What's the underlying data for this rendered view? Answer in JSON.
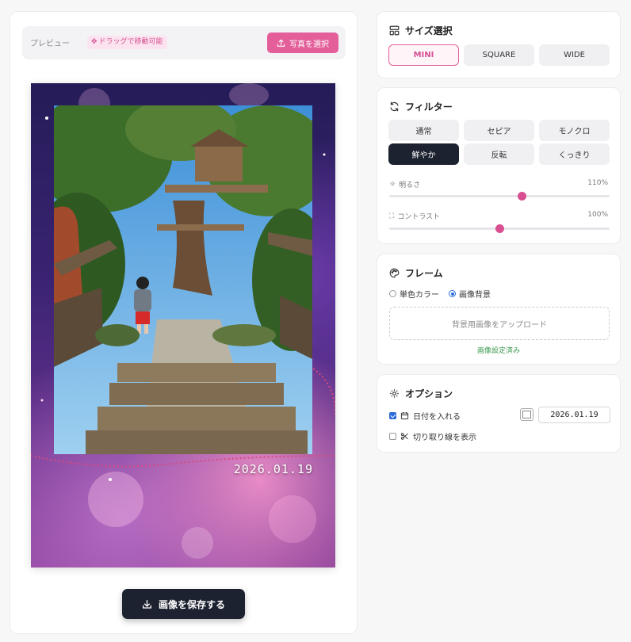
{
  "preview": {
    "label": "プレビュー",
    "drag_hint": "ドラッグで移動可能",
    "select_photo": "写真を選択",
    "date_stamp": "2026.01.19",
    "save_button": "画像を保存する"
  },
  "size": {
    "title": "サイズ選択",
    "options": [
      "MINI",
      "SQUARE",
      "WIDE"
    ],
    "selected": "MINI"
  },
  "filter": {
    "title": "フィルター",
    "options": [
      "通常",
      "セピア",
      "モノクロ",
      "鮮やか",
      "反転",
      "くっきり"
    ],
    "selected": "鮮やか",
    "brightness": {
      "label": "明るさ",
      "value": "110%",
      "level": 0.6
    },
    "contrast": {
      "label": "コントラスト",
      "value": "100%",
      "level": 0.5
    }
  },
  "frame": {
    "title": "フレーム",
    "solid_color": "単色カラー",
    "image_background": "画像背景",
    "mode": "image",
    "upload_label": "背景用画像をアップロード",
    "status": "画像設定済み"
  },
  "options": {
    "title": "オプション",
    "date_label": "日付を入れる",
    "date_checked": true,
    "date_value": "2026.01.19",
    "cutline_label": "切り取り線を表示",
    "cutline_checked": false
  },
  "colors": {
    "accent_pink": "#e45e99",
    "dark_button": "#1d2230",
    "success_green": "#3a9a4e"
  }
}
